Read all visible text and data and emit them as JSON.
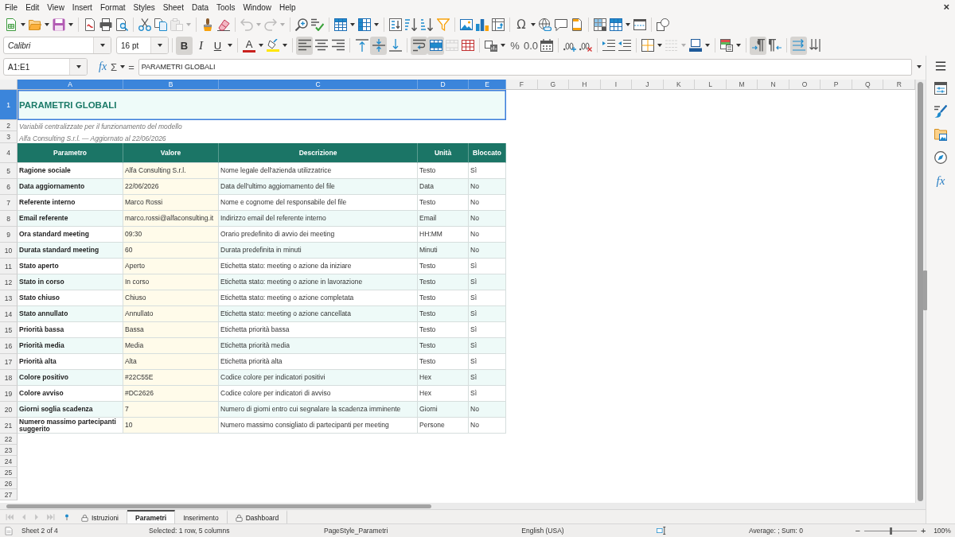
{
  "menu_bar": {
    "items": [
      "File",
      "Edit",
      "View",
      "Insert",
      "Format",
      "Styles",
      "Sheet",
      "Data",
      "Tools",
      "Window",
      "Help"
    ],
    "close": "×"
  },
  "standard_toolbar": {
    "paste": {
      "disabled": true
    },
    "undo": {
      "disabled": true
    },
    "redo": {
      "disabled": true
    },
    "special_character": "Ω"
  },
  "formatting_toolbar": {
    "font_name": "Calibri",
    "font_size": "16 pt",
    "bold": {
      "label": "B",
      "on": true
    },
    "italic": {
      "label": "I",
      "on": false
    },
    "underline": {
      "label": "U",
      "on": false
    },
    "font_color": "A",
    "align_left": {
      "on": true
    },
    "align_center": {
      "on": false
    },
    "align_right": {
      "on": false
    },
    "align_top": {
      "on": false
    },
    "align_middle": {
      "on": true
    },
    "align_bottom": {
      "on": false
    },
    "wrap_text": {
      "on": true
    },
    "merge_center": {
      "on": true
    },
    "merge_cells": {
      "disabled": true
    },
    "percent": "%",
    "number": "0.0",
    "border_style": {
      "disabled": true
    },
    "left_to_right": {
      "on": true
    },
    "right_to_left": {
      "on": false
    },
    "text_horizontal": {
      "on": true
    },
    "text_vertical": {
      "on": false
    }
  },
  "formula_bar": {
    "name_box": "A1:E1",
    "function_wizard": "fx",
    "sum": "Σ",
    "equals": "=",
    "content": "PARAMETRI GLOBALI"
  },
  "column_headers": [
    {
      "label": "A",
      "selected": true
    },
    {
      "label": "B",
      "selected": true
    },
    {
      "label": "C",
      "selected": true
    },
    {
      "label": "D",
      "selected": true
    },
    {
      "label": "E",
      "selected": true
    },
    {
      "label": "F",
      "selected": false
    },
    {
      "label": "G",
      "selected": false
    },
    {
      "label": "H",
      "selected": false
    },
    {
      "label": "I",
      "selected": false
    },
    {
      "label": "J",
      "selected": false
    },
    {
      "label": "K",
      "selected": false
    },
    {
      "label": "L",
      "selected": false
    },
    {
      "label": "M",
      "selected": false
    },
    {
      "label": "N",
      "selected": false
    },
    {
      "label": "O",
      "selected": false
    },
    {
      "label": "P",
      "selected": false
    },
    {
      "label": "Q",
      "selected": false
    },
    {
      "label": "R",
      "selected": false
    }
  ],
  "row_headers": [
    {
      "label": "1",
      "selected": true
    },
    {
      "label": "2",
      "selected": false
    },
    {
      "label": "3",
      "selected": false
    },
    {
      "label": "4",
      "selected": false
    },
    {
      "label": "5",
      "selected": false
    },
    {
      "label": "6",
      "selected": false
    },
    {
      "label": "7",
      "selected": false
    },
    {
      "label": "8",
      "selected": false
    },
    {
      "label": "9",
      "selected": false
    },
    {
      "label": "10",
      "selected": false
    },
    {
      "label": "11",
      "selected": false
    },
    {
      "label": "12",
      "selected": false
    },
    {
      "label": "13",
      "selected": false
    },
    {
      "label": "14",
      "selected": false
    },
    {
      "label": "15",
      "selected": false
    },
    {
      "label": "16",
      "selected": false
    },
    {
      "label": "17",
      "selected": false
    },
    {
      "label": "18",
      "selected": false
    },
    {
      "label": "19",
      "selected": false
    },
    {
      "label": "20",
      "selected": false
    },
    {
      "label": "21",
      "selected": false
    },
    {
      "label": "22",
      "selected": false
    },
    {
      "label": "23",
      "selected": false
    },
    {
      "label": "24",
      "selected": false
    },
    {
      "label": "25",
      "selected": false
    },
    {
      "label": "26",
      "selected": false
    },
    {
      "label": "27",
      "selected": false
    }
  ],
  "sheet": {
    "title": "PARAMETRI GLOBALI",
    "subtitle": "Variabili centralizzate per il funzionamento del modello",
    "info": "Alfa Consulting S.r.l. — Aggiornato al 22/06/2026",
    "table": {
      "columns": [
        "Parametro",
        "Valore",
        "Descrizione",
        "Unità",
        "Bloccato"
      ],
      "rows": [
        {
          "parameter": "Ragione sociale",
          "value": "Alfa Consulting S.r.l.",
          "description": "Nome legale dell'azienda utilizzatrice",
          "unit": "Testo",
          "locked": "Sì"
        },
        {
          "parameter": "Data aggiornamento",
          "value": "22/06/2026",
          "description": "Data dell'ultimo aggiornamento del file",
          "unit": "Data",
          "locked": "No"
        },
        {
          "parameter": "Referente interno",
          "value": "Marco Rossi",
          "description": "Nome e cognome del responsabile del file",
          "unit": "Testo",
          "locked": "No"
        },
        {
          "parameter": "Email referente",
          "value": "marco.rossi@alfaconsulting.it",
          "description": "Indirizzo email del referente interno",
          "unit": "Email",
          "locked": "No"
        },
        {
          "parameter": "Ora standard meeting",
          "value": "09:30",
          "description": "Orario predefinito di avvio dei meeting",
          "unit": "HH:MM",
          "locked": "No"
        },
        {
          "parameter": "Durata standard meeting",
          "value": "60",
          "description": "Durata predefinita in minuti",
          "unit": "Minuti",
          "locked": "No"
        },
        {
          "parameter": "Stato aperto",
          "value": "Aperto",
          "description": "Etichetta stato: meeting o azione da iniziare",
          "unit": "Testo",
          "locked": "Sì"
        },
        {
          "parameter": "Stato in corso",
          "value": "In corso",
          "description": "Etichetta stato: meeting o azione in lavorazione",
          "unit": "Testo",
          "locked": "Sì"
        },
        {
          "parameter": "Stato chiuso",
          "value": "Chiuso",
          "description": "Etichetta stato: meeting o azione completata",
          "unit": "Testo",
          "locked": "Sì"
        },
        {
          "parameter": "Stato annullato",
          "value": "Annullato",
          "description": "Etichetta stato: meeting o azione cancellata",
          "unit": "Testo",
          "locked": "Sì"
        },
        {
          "parameter": "Priorità bassa",
          "value": "Bassa",
          "description": "Etichetta priorità bassa",
          "unit": "Testo",
          "locked": "Sì"
        },
        {
          "parameter": "Priorità media",
          "value": "Media",
          "description": "Etichetta priorità media",
          "unit": "Testo",
          "locked": "Sì"
        },
        {
          "parameter": "Priorità alta",
          "value": "Alta",
          "description": "Etichetta priorità alta",
          "unit": "Testo",
          "locked": "Sì"
        },
        {
          "parameter": "Colore positivo",
          "value": "#22C55E",
          "description": "Codice colore per indicatori positivi",
          "unit": "Hex",
          "locked": "Sì"
        },
        {
          "parameter": "Colore avviso",
          "value": "#DC2626",
          "description": "Codice colore per indicatori di avviso",
          "unit": "Hex",
          "locked": "Sì"
        },
        {
          "parameter": "Giorni soglia scadenza",
          "value": "7",
          "description": "Numero di giorni entro cui segnalare la scadenza imminente",
          "unit": "Giorni",
          "locked": "No"
        },
        {
          "parameter": "Numero massimo partecipanti suggerito",
          "value": "10",
          "description": "Numero massimo consigliato di partecipanti per meeting",
          "unit": "Persone",
          "locked": "No"
        }
      ]
    }
  },
  "sheet_tabs": [
    {
      "label": "Istruzioni",
      "selected": false,
      "protected": true
    },
    {
      "label": "Parametri",
      "selected": true,
      "protected": false
    },
    {
      "label": "Inserimento",
      "selected": false,
      "protected": false
    },
    {
      "label": "Dashboard",
      "selected": false,
      "protected": true
    }
  ],
  "status_bar": {
    "sheet": "Sheet 2 of 4",
    "selection": "Selected: 1 row, 5 columns",
    "page_style": "PageStyle_Parametri",
    "language": "English (USA)",
    "summary": "Average: ; Sum: 0",
    "zoom": {
      "minus": "−",
      "plus": "+",
      "level": 0.5,
      "percent": "100%"
    }
  },
  "sidebar": {
    "functions": "fx"
  }
}
